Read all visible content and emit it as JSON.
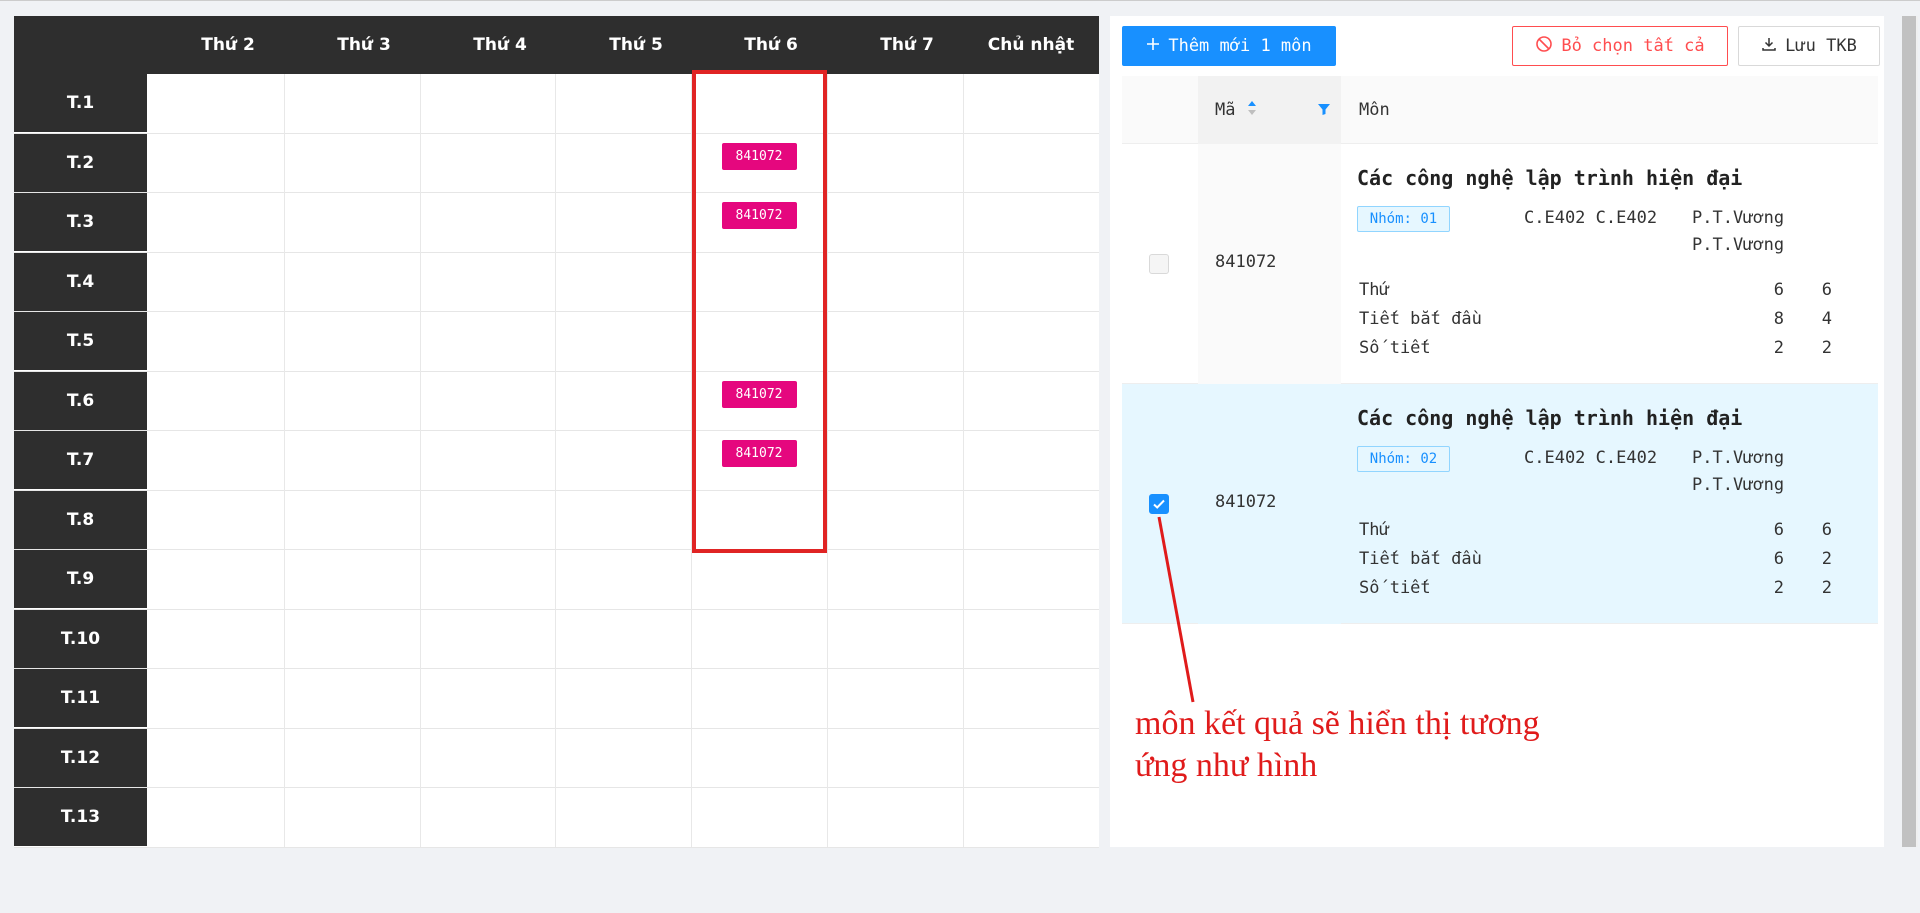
{
  "timetable": {
    "days": [
      "Thứ 2",
      "Thứ 3",
      "Thứ 4",
      "Thứ 5",
      "Thứ 6",
      "Thứ 7",
      "Chủ nhật"
    ],
    "periods": [
      "T.1",
      "T.2",
      "T.3",
      "T.4",
      "T.5",
      "T.6",
      "T.7",
      "T.8",
      "T.9",
      "T.10",
      "T.11",
      "T.12",
      "T.13"
    ],
    "entries": [
      {
        "day": "Thứ 6",
        "period": "T.2",
        "code": "841072"
      },
      {
        "day": "Thứ 6",
        "period": "T.3",
        "code": "841072"
      },
      {
        "day": "Thứ 6",
        "period": "T.6",
        "code": "841072"
      },
      {
        "day": "Thứ 6",
        "period": "T.7",
        "code": "841072"
      }
    ],
    "tag_color": "#e5077e"
  },
  "toolbar": {
    "add_label": "Thêm mới 1 môn",
    "clear_label": "Bỏ chọn tất cả",
    "save_label": "Lưu TKB"
  },
  "table": {
    "col_code": "Mã",
    "col_subject": "Môn",
    "rows": [
      {
        "checked": false,
        "code": "841072",
        "title": "Các công nghệ lập trình hiện đại",
        "group": "Nhóm: 01",
        "rooms": "C.E402 C.E402",
        "teacher1": "P.T.Vương",
        "teacher2": "P.T.Vương",
        "day_label": "Thứ",
        "start_label": "Tiết bắt đầu",
        "count_label": "Số tiết",
        "day_a": "6",
        "day_b": "6",
        "start_a": "8",
        "start_b": "4",
        "count_a": "2",
        "count_b": "2"
      },
      {
        "checked": true,
        "code": "841072",
        "title": "Các công nghệ lập trình hiện đại",
        "group": "Nhóm: 02",
        "rooms": "C.E402 C.E402",
        "teacher1": "P.T.Vương",
        "teacher2": "P.T.Vương",
        "day_label": "Thứ",
        "start_label": "Tiết bắt đầu",
        "count_label": "Số tiết",
        "day_a": "6",
        "day_b": "6",
        "start_a": "6",
        "start_b": "2",
        "count_a": "2",
        "count_b": "2"
      }
    ]
  },
  "annotation": {
    "text": "môn kết quả sẽ hiển thị tương ứng như hình",
    "color": "#e01b1b"
  },
  "colors": {
    "primary": "#1890ff",
    "danger": "#ff4d4f",
    "dark": "#2e2e2e",
    "highlight": "#e02424"
  }
}
